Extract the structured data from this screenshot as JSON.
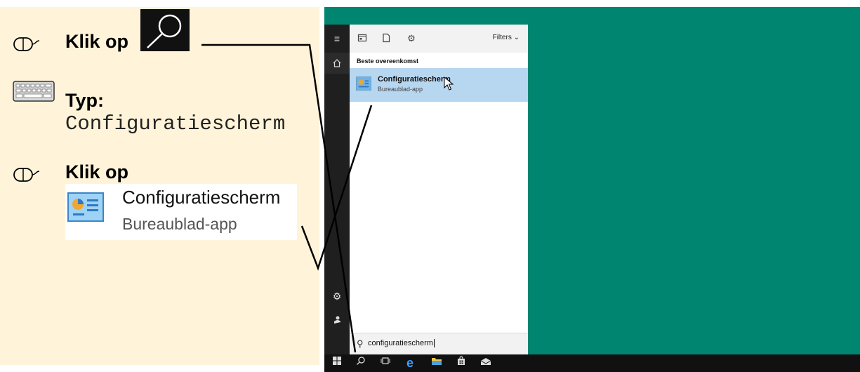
{
  "instructions": {
    "step1": {
      "text": "Klik op",
      "icon": "mouse-icon",
      "thumbnail_icon": "search-icon"
    },
    "step2": {
      "text": "Typ:",
      "icon": "keyboard-icon",
      "typed": "Configuratiescherm"
    },
    "step3": {
      "text": "Klik op",
      "icon": "mouse-icon",
      "result_title": "Configuratiescherm",
      "result_subtitle": "Bureaublad-app"
    }
  },
  "start_menu": {
    "filters_label": "Filters",
    "best_match_label": "Beste overeenkomst",
    "best_match": {
      "title": "Configuratiescherm",
      "subtitle": "Bureaublad-app",
      "icon": "control-panel-icon"
    }
  },
  "search": {
    "value": "configuratiescherm"
  },
  "colors": {
    "instruction_bg": "#fff4d9",
    "desktop_bg": "#008571",
    "selected_result": "#b7d6f0",
    "taskbar": "#111111"
  }
}
